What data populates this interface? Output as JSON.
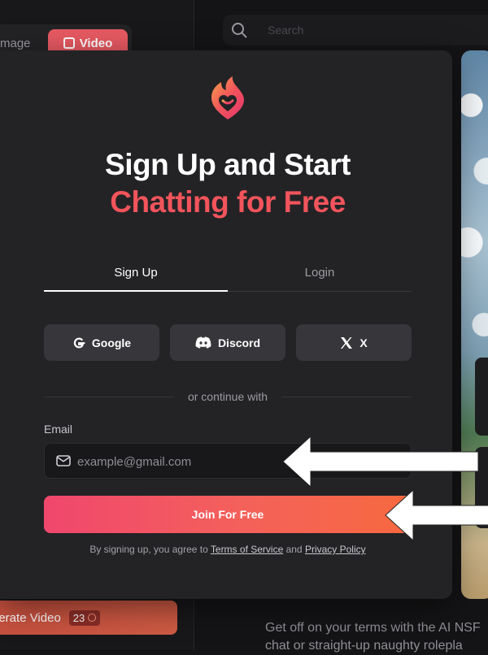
{
  "background": {
    "tabs": {
      "image_label": "mage",
      "video_label": "Video"
    },
    "search": {
      "placeholder": "Search"
    },
    "generate": {
      "label": "nerate Video",
      "count": "23"
    },
    "tagline": {
      "line1": "Get off on your terms with the AI NSF",
      "line2": "chat or straight-up naughty rolepla"
    }
  },
  "modal": {
    "title_line1": "Sign Up and Start",
    "title_line2": "Chatting for Free",
    "tabs": [
      {
        "label": "Sign Up",
        "active": true
      },
      {
        "label": "Login",
        "active": false
      }
    ],
    "social": [
      {
        "label": "Google",
        "icon": "google-icon"
      },
      {
        "label": "Discord",
        "icon": "discord-icon"
      },
      {
        "label": "X",
        "icon": "x-icon"
      }
    ],
    "divider_text": "or continue with",
    "email": {
      "label": "Email",
      "placeholder": "example@gmail.com",
      "value": ""
    },
    "submit_label": "Join For Free",
    "terms": {
      "prefix": "By signing up, you agree to ",
      "tos": "Terms of Service",
      "and": " and ",
      "privacy": "Privacy Policy"
    }
  },
  "colors": {
    "accent": "#f2545b",
    "modal_bg": "#232326",
    "button_gradient_start": "#f0476d",
    "button_gradient_end": "#f7693f"
  }
}
